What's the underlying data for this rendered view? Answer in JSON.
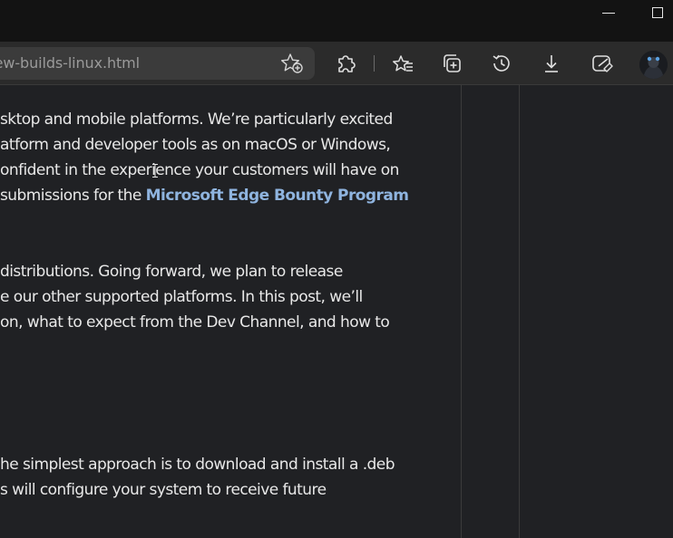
{
  "window": {
    "minimize_icon": "minimize-icon",
    "maximize_icon": "maximize-icon"
  },
  "address_bar": {
    "url_text": "ew-builds-linux.html",
    "favorite_icon": "star-plus-icon"
  },
  "toolbar": {
    "buttons": [
      {
        "name": "extensions-button",
        "icon": "puzzle-icon"
      },
      {
        "name": "favorites-button",
        "icon": "star-list-icon"
      },
      {
        "name": "collections-button",
        "icon": "collections-icon"
      },
      {
        "name": "history-button",
        "icon": "history-icon"
      },
      {
        "name": "downloads-button",
        "icon": "download-icon"
      },
      {
        "name": "performance-button",
        "icon": "heart-pulse-icon"
      }
    ],
    "profile_icon": "avatar"
  },
  "article": {
    "paragraph1": {
      "line1": "sktop and mobile platforms. We’re particularly excited",
      "line2": "atform and developer tools as on macOS or Windows,",
      "line3": "onfident in the experience your customers will have on",
      "line4_prefix": "submissions for the ",
      "line4_link": "Microsoft Edge Bounty Program"
    },
    "paragraph2": {
      "line1": "distributions. Going forward, we plan to release",
      "line2": "e our other supported platforms. In this post, we’ll",
      "line3": "on, what to expect from the Dev Channel, and how to"
    },
    "paragraph3": {
      "line1": "he simplest approach is to download and install a .deb",
      "line2": "s will configure your system to receive future"
    }
  },
  "colors": {
    "background": "#202124",
    "text": "#e8e8e8",
    "link": "#8fb4df",
    "titlebar": "#131313",
    "toolbar": "#2b2b2b",
    "address_bar": "#3b3b3b"
  }
}
